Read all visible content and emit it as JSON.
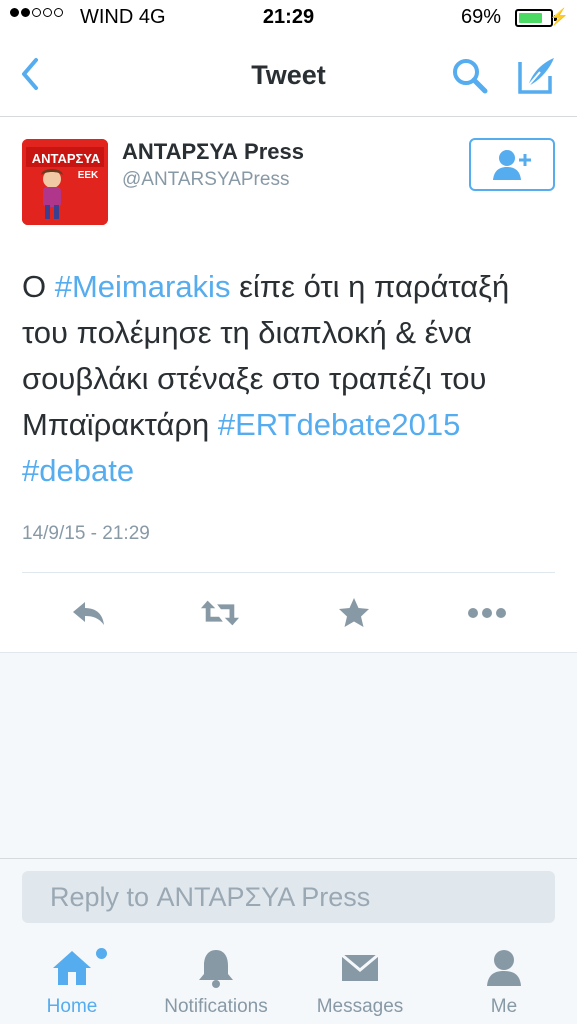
{
  "status_bar": {
    "carrier": "WIND   4G",
    "time": "21:29",
    "battery_percent": "69%",
    "battery_level": 0.69
  },
  "nav": {
    "title": "Tweet",
    "back_icon": "chevron-left-icon",
    "search_icon": "search-icon",
    "compose_icon": "compose-quill-icon"
  },
  "tweet": {
    "author_name": "ΑΝΤΑΡΣΥΑ Press",
    "author_handle": "@ANTARSYAPress",
    "avatar_text": "ΑΝΤΑΡΣΥΑ",
    "avatar_subtext": "ΕΕΚ",
    "text_parts": [
      {
        "text": "Ο ",
        "hashtag": false
      },
      {
        "text": "#Meimarakis",
        "hashtag": true
      },
      {
        "text": " είπε ότι η παράταξή του πολέμησε τη διαπλοκή & ένα σουβλάκι στέναξε στο τραπέζι του Μπαϊρακτάρη ",
        "hashtag": false
      },
      {
        "text": "#ERTdebate2015",
        "hashtag": true
      },
      {
        "text": " ",
        "hashtag": false
      },
      {
        "text": "#debate",
        "hashtag": true
      }
    ],
    "timestamp": "14/9/15 - 21:29"
  },
  "reply": {
    "placeholder": "Reply to ΑΝΤΑΡΣΥΑ Press"
  },
  "tabs": [
    {
      "label": "Home",
      "icon": "home-icon"
    },
    {
      "label": "Notifications",
      "icon": "bell-icon"
    },
    {
      "label": "Messages",
      "icon": "envelope-icon"
    },
    {
      "label": "Me",
      "icon": "person-icon"
    }
  ],
  "colors": {
    "accent": "#55acee",
    "text": "#292f33",
    "muted": "#8899a6",
    "battery": "#4cd964",
    "avatar_red": "#e2241f"
  }
}
